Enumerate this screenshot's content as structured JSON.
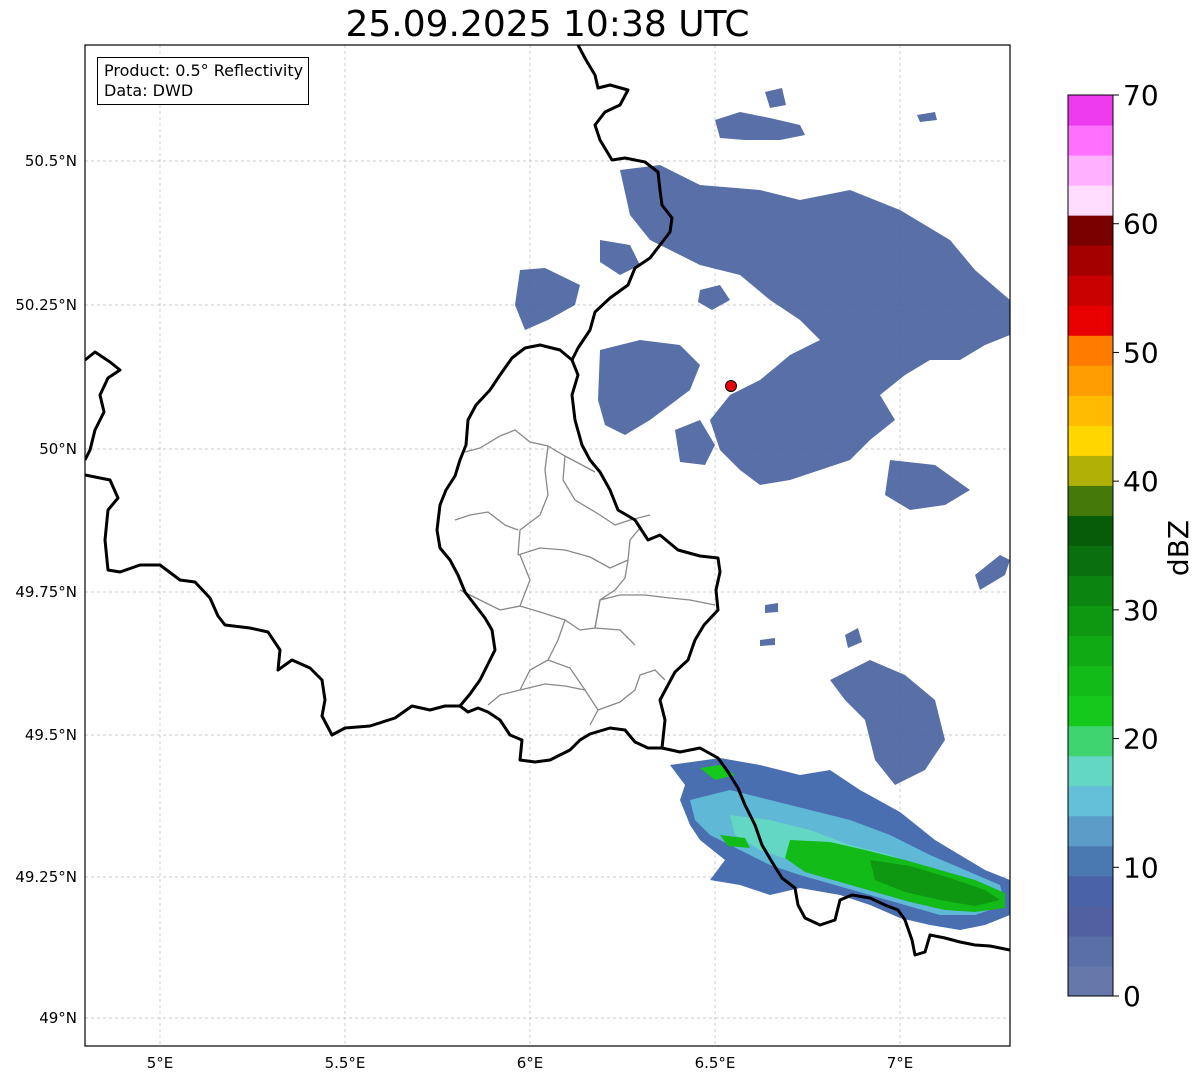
{
  "title": "25.09.2025 10:38 UTC",
  "info": {
    "product": "Product: 0.5° Reflectivity",
    "data": "Data: DWD"
  },
  "axes": {
    "lon_ticks": [
      "5°E",
      "5.5°E",
      "6°E",
      "6.5°E",
      "7°E"
    ],
    "lat_ticks": [
      "50.5°N",
      "50.25°N",
      "50°N",
      "49.75°N",
      "49.5°N",
      "49.25°N",
      "49°N"
    ]
  },
  "colorbar": {
    "label": "dBZ",
    "tick_labels": [
      "0",
      "10",
      "20",
      "30",
      "40",
      "50",
      "60",
      "70"
    ],
    "colors": [
      "#6677aa",
      "#5a6fa5",
      "#5060a0",
      "#4a62a8",
      "#4a78b0",
      "#5b9cc8",
      "#63c0d8",
      "#64d6c4",
      "#3fd470",
      "#14c81c",
      "#12bb18",
      "#10aa14",
      "#0e9812",
      "#0c8410",
      "#0a700e",
      "#075c0a",
      "#457a0a",
      "#b0b007",
      "#ffd600",
      "#ffbb00",
      "#ff9c00",
      "#ff7c00",
      "#e80000",
      "#c80000",
      "#a40000",
      "#7a0000",
      "#ffddff",
      "#ffb0ff",
      "#ff70ff",
      "#ee3aee"
    ]
  },
  "radar_site": {
    "color": "#e8000b"
  },
  "colors": {
    "border": "#000000",
    "district": "#888888",
    "grid": "#bbbbbb",
    "echo_weak": "#4a63a0",
    "echo_mid": "#5fb8d6",
    "echo_strong": "#12bb18"
  }
}
